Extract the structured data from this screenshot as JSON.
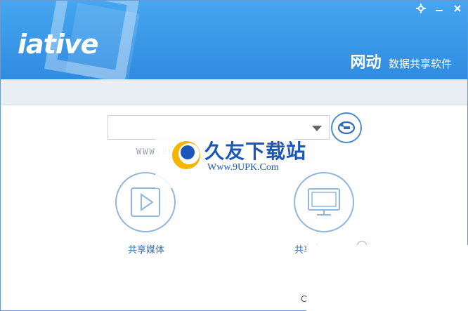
{
  "app": {
    "logo_text": "iative",
    "title_main": "网动",
    "title_sub": "数据共享软件"
  },
  "window_controls": [
    {
      "name": "settings-icon",
      "glyph": "✿"
    },
    {
      "name": "minimize-icon",
      "glyph": "—"
    },
    {
      "name": "close-icon",
      "glyph": "✕"
    }
  ],
  "combo": {
    "value": ""
  },
  "actions": {
    "share_media_label": "共享媒体",
    "share_desktop_label": "共享桌面(流畅)"
  },
  "watermark": {
    "faint_url": "WWW.9UPK.COM",
    "brand": "久友下载站",
    "url": "Www.9UPK.Com"
  },
  "footer": {
    "partial_text": "C"
  },
  "colors": {
    "header": "#2f8be0",
    "accent": "#3a6ea5",
    "circle_border": "#8fb6de"
  }
}
